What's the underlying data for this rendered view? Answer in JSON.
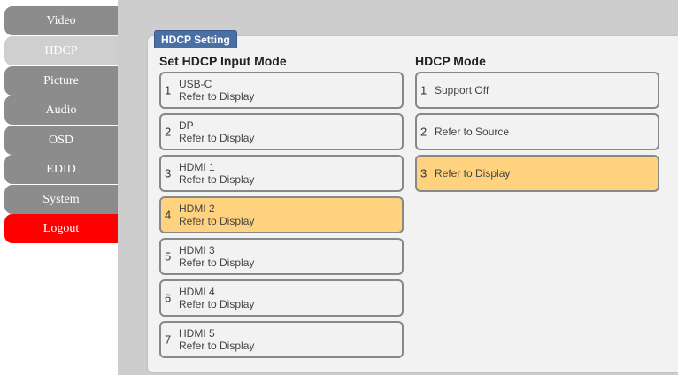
{
  "nav": {
    "items": [
      {
        "label": "Video"
      },
      {
        "label": "HDCP"
      },
      {
        "label": "Picture"
      },
      {
        "label": "Audio"
      },
      {
        "label": "OSD"
      },
      {
        "label": "EDID"
      },
      {
        "label": "System"
      },
      {
        "label": "Logout"
      }
    ],
    "active": "HDCP"
  },
  "panel": {
    "tab_label": "HDCP Setting",
    "input_title": "Set HDCP Input Mode",
    "mode_title": "HDCP Mode"
  },
  "inputs": [
    {
      "num": "1",
      "name": "USB-C",
      "mode": "Refer to Display",
      "selected": false
    },
    {
      "num": "2",
      "name": "DP",
      "mode": "Refer to Display",
      "selected": false
    },
    {
      "num": "3",
      "name": "HDMI 1",
      "mode": "Refer to Display",
      "selected": false
    },
    {
      "num": "4",
      "name": "HDMI 2",
      "mode": "Refer to Display",
      "selected": true
    },
    {
      "num": "5",
      "name": "HDMI 3",
      "mode": "Refer to Display",
      "selected": false
    },
    {
      "num": "6",
      "name": "HDMI 4",
      "mode": "Refer to Display",
      "selected": false
    },
    {
      "num": "7",
      "name": "HDMI 5",
      "mode": "Refer to Display",
      "selected": false
    }
  ],
  "modes": [
    {
      "num": "1",
      "label": "Support Off",
      "selected": false
    },
    {
      "num": "2",
      "label": "Refer to Source",
      "selected": false
    },
    {
      "num": "3",
      "label": "Refer to Display",
      "selected": true
    }
  ],
  "colors": {
    "nav": "#8c8c8c",
    "nav_active": "#cfcfcf",
    "logout": "#ff0000",
    "selected": "#ffd27f",
    "tab": "#4a6fa5"
  }
}
